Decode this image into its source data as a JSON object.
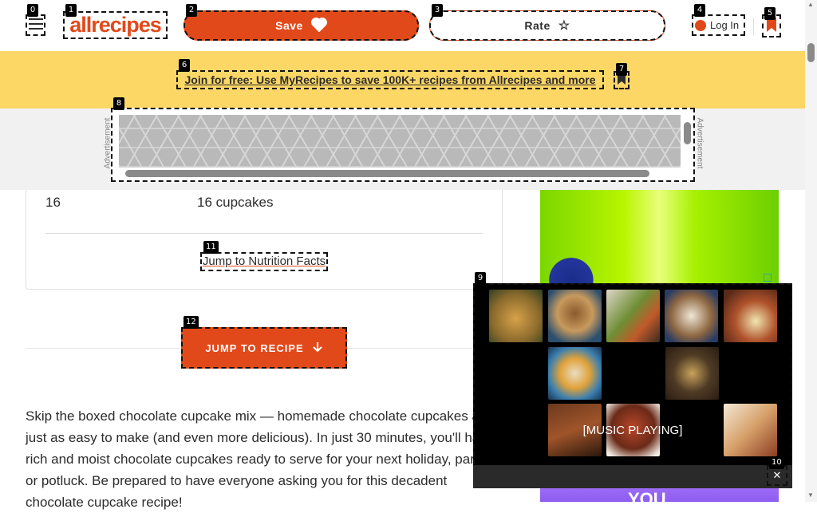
{
  "header": {
    "logo_text": "allrecipes",
    "save_label": "Save",
    "rate_label": "Rate",
    "login_label": "Log In"
  },
  "banner": {
    "text": "Join for free: Use MyRecipes to save 100K+ recipes from Allrecipes and more"
  },
  "ad": {
    "label": "Advertisement"
  },
  "servings": {
    "left_value": "16",
    "right_value": "16 cupcakes",
    "nutrition_link": "Jump to Nutrition Facts"
  },
  "jump_button": {
    "label": "JUMP TO RECIPE"
  },
  "video": {
    "caption": "[MUSIC PLAYING]"
  },
  "article": {
    "paragraph": "Skip the boxed chocolate cupcake mix — homemade chocolate cupcakes are just as easy to make (and even more delicious). In just 30 minutes, you'll have rich and moist chocolate cupcakes ready to serve for your next holiday, party, or potluck. Be prepared to have everyone asking you for this decadent chocolate cupcake recipe!"
  },
  "ad_bottom_text": "YOU",
  "tags": [
    "0",
    "1",
    "2",
    "3",
    "4",
    "5",
    "6",
    "7",
    "8",
    "9",
    "10",
    "11",
    "12"
  ],
  "colors": {
    "brand_orange": "#e2491a",
    "banner_yellow": "#fcd766",
    "video_bg": "#000000"
  },
  "icons": [
    "hamburger-menu-icon",
    "heart-icon",
    "star-icon",
    "user-icon",
    "bookmark-heart-icon",
    "bookmark-icon",
    "arrow-down-icon",
    "close-icon"
  ]
}
